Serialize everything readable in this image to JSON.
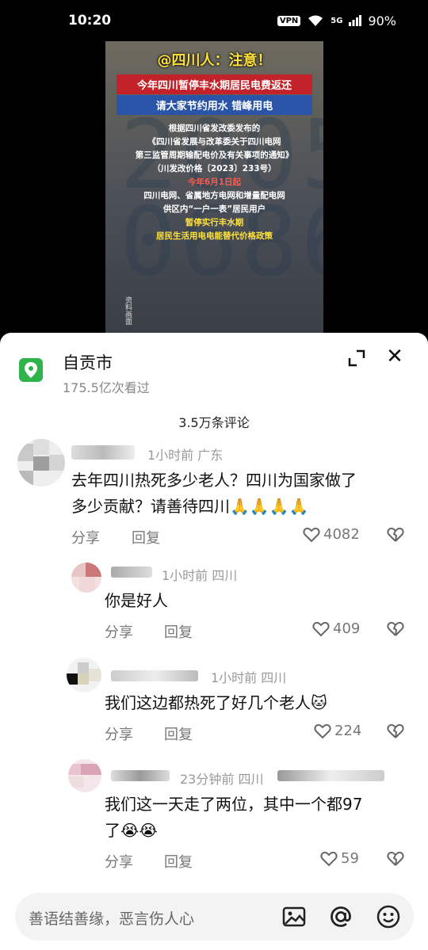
{
  "status": {
    "time": "10:20",
    "vpn": "VPN",
    "network": "5G",
    "battery": "90%"
  },
  "video": {
    "title": "@四川人：注意！",
    "sub1": "今年四川暂停丰水期居民电费返还",
    "sub2": "请大家节约用水 错峰用电",
    "body": [
      "根据四川省发改委发布的",
      "《四川省发展与改革委关于四川电网",
      "第三监管周期输配电价及有关事项的通知》",
      "（川发改价格〔2023〕233号）"
    ],
    "date": "今年6月1日起",
    "body2": [
      "四川电网、省属地方电网和增量配电网",
      "供区内“一户一表”居民用户"
    ],
    "yellow1": "暂停实行丰水期",
    "yellow2": "居民生活用电电能替代价格政策",
    "side": "资料画面"
  },
  "location": {
    "title": "自贡市",
    "views": "175.5亿次看过"
  },
  "comments_count": "3.5万条评论",
  "comments": [
    {
      "meta": "1小时前 广东",
      "text1": "去年四川热死多少老人？四川为国家做了",
      "text2": "多少贡献？请善待四川🙏🙏🙏🙏",
      "share": "分享",
      "reply": "回复",
      "likes": "4082"
    },
    {
      "meta": "1小时前 四川",
      "text1": "你是好人",
      "share": "分享",
      "reply": "回复",
      "likes": "409"
    },
    {
      "meta": "1小时前 四川",
      "text1": "我们这边都热死了好几个老人🐱",
      "share": "分享",
      "reply": "回复",
      "likes": "224"
    },
    {
      "meta": "23分钟前 四川",
      "text1": "我们这一天走了两位，其中一个都97",
      "text2": "了😭😭",
      "share": "分享",
      "reply": "回复",
      "likes": "59"
    }
  ],
  "input": {
    "placeholder": "善语结善缘，恶言伤人心"
  }
}
